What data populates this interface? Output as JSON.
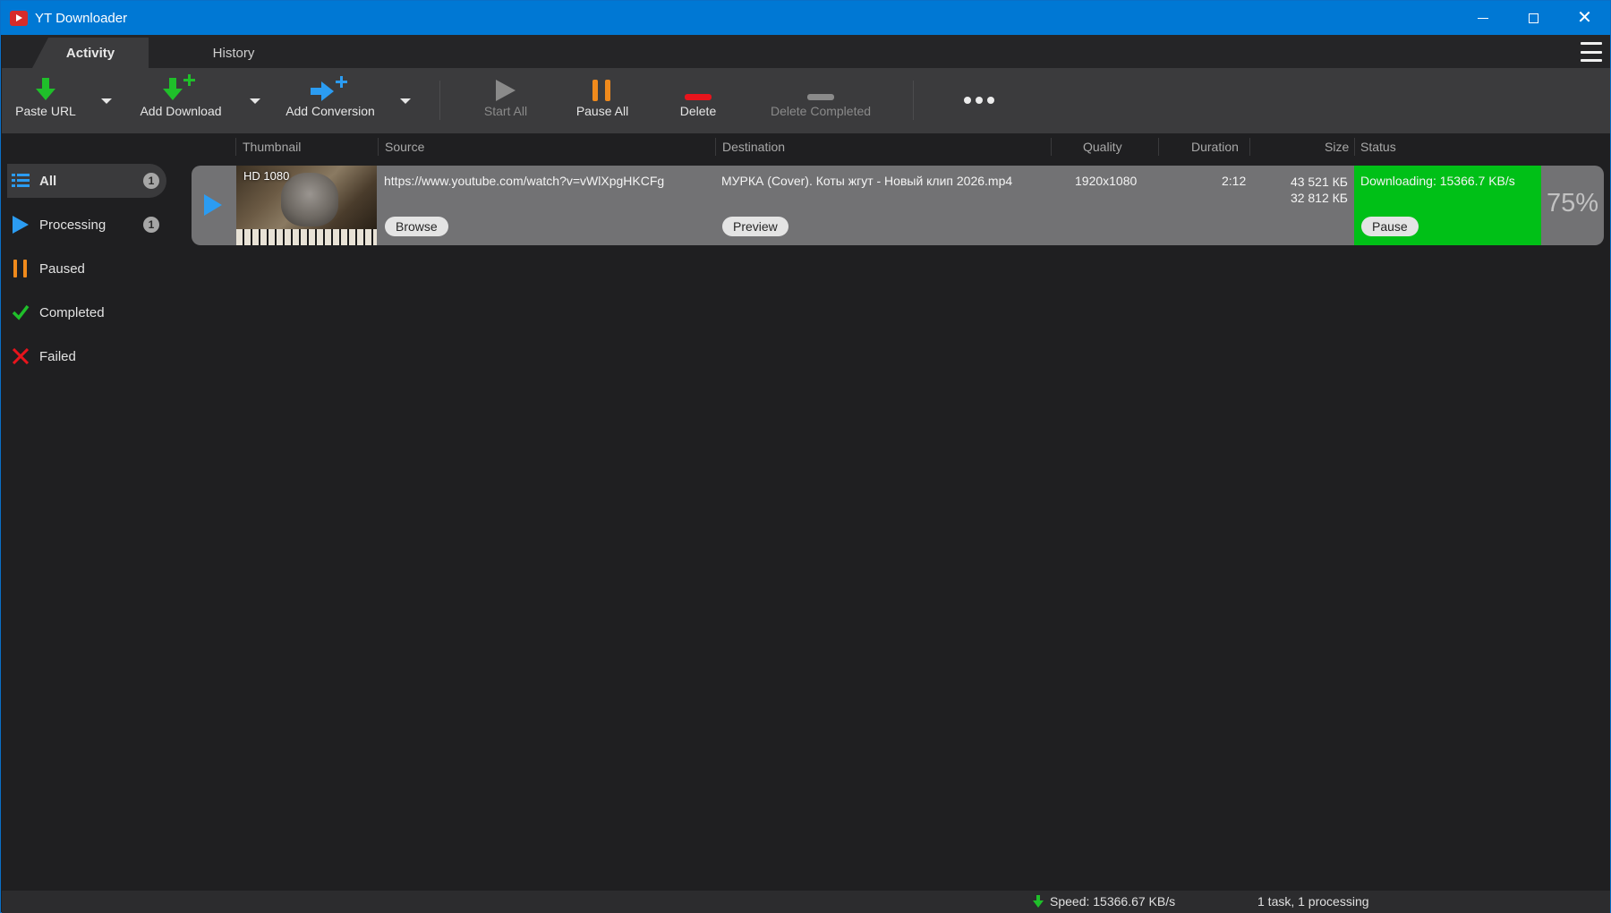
{
  "window": {
    "title": "YT Downloader"
  },
  "tabs": [
    {
      "label": "Activity",
      "active": true
    },
    {
      "label": "History",
      "active": false
    }
  ],
  "toolbar": {
    "paste_url": "Paste URL",
    "add_download": "Add Download",
    "add_conversion": "Add Conversion",
    "start_all": "Start All",
    "pause_all": "Pause All",
    "delete": "Delete",
    "delete_completed": "Delete Completed"
  },
  "sidebar": {
    "items": [
      {
        "label": "All",
        "count": "1",
        "selected": true,
        "icon": "list-icon"
      },
      {
        "label": "Processing",
        "count": "1",
        "selected": false,
        "icon": "play-icon"
      },
      {
        "label": "Paused",
        "count": "",
        "selected": false,
        "icon": "pause-icon"
      },
      {
        "label": "Completed",
        "count": "",
        "selected": false,
        "icon": "check-icon"
      },
      {
        "label": "Failed",
        "count": "",
        "selected": false,
        "icon": "x-icon"
      }
    ]
  },
  "columns": {
    "thumbnail": "Thumbnail",
    "source": "Source",
    "destination": "Destination",
    "quality": "Quality",
    "duration": "Duration",
    "size": "Size",
    "status": "Status"
  },
  "downloads": [
    {
      "thumb_label": "HD 1080",
      "source": "https://www.youtube.com/watch?v=vWlXpgHKCFg",
      "browse_label": "Browse",
      "destination": "МУРКА (Cover). Коты жгут - Новый клип 2026.mp4",
      "preview_label": "Preview",
      "quality": "1920x1080",
      "duration": "2:12",
      "size_total": "43 521 КБ",
      "size_done": "32 812 КБ",
      "status_text": "Downloading: 15366.7 KB/s",
      "pause_label": "Pause",
      "progress": "75%"
    }
  ],
  "statusbar": {
    "speed": "Speed: 15366.67 KB/s",
    "tasks": "1 task, 1 processing"
  },
  "colors": {
    "titlebar": "#0078d4",
    "status_green": "#00c017",
    "accent_blue": "#2b9cf2",
    "pause_orange": "#f08a1c",
    "delete_red": "#e8141c",
    "add_green": "#1fbf2a"
  }
}
